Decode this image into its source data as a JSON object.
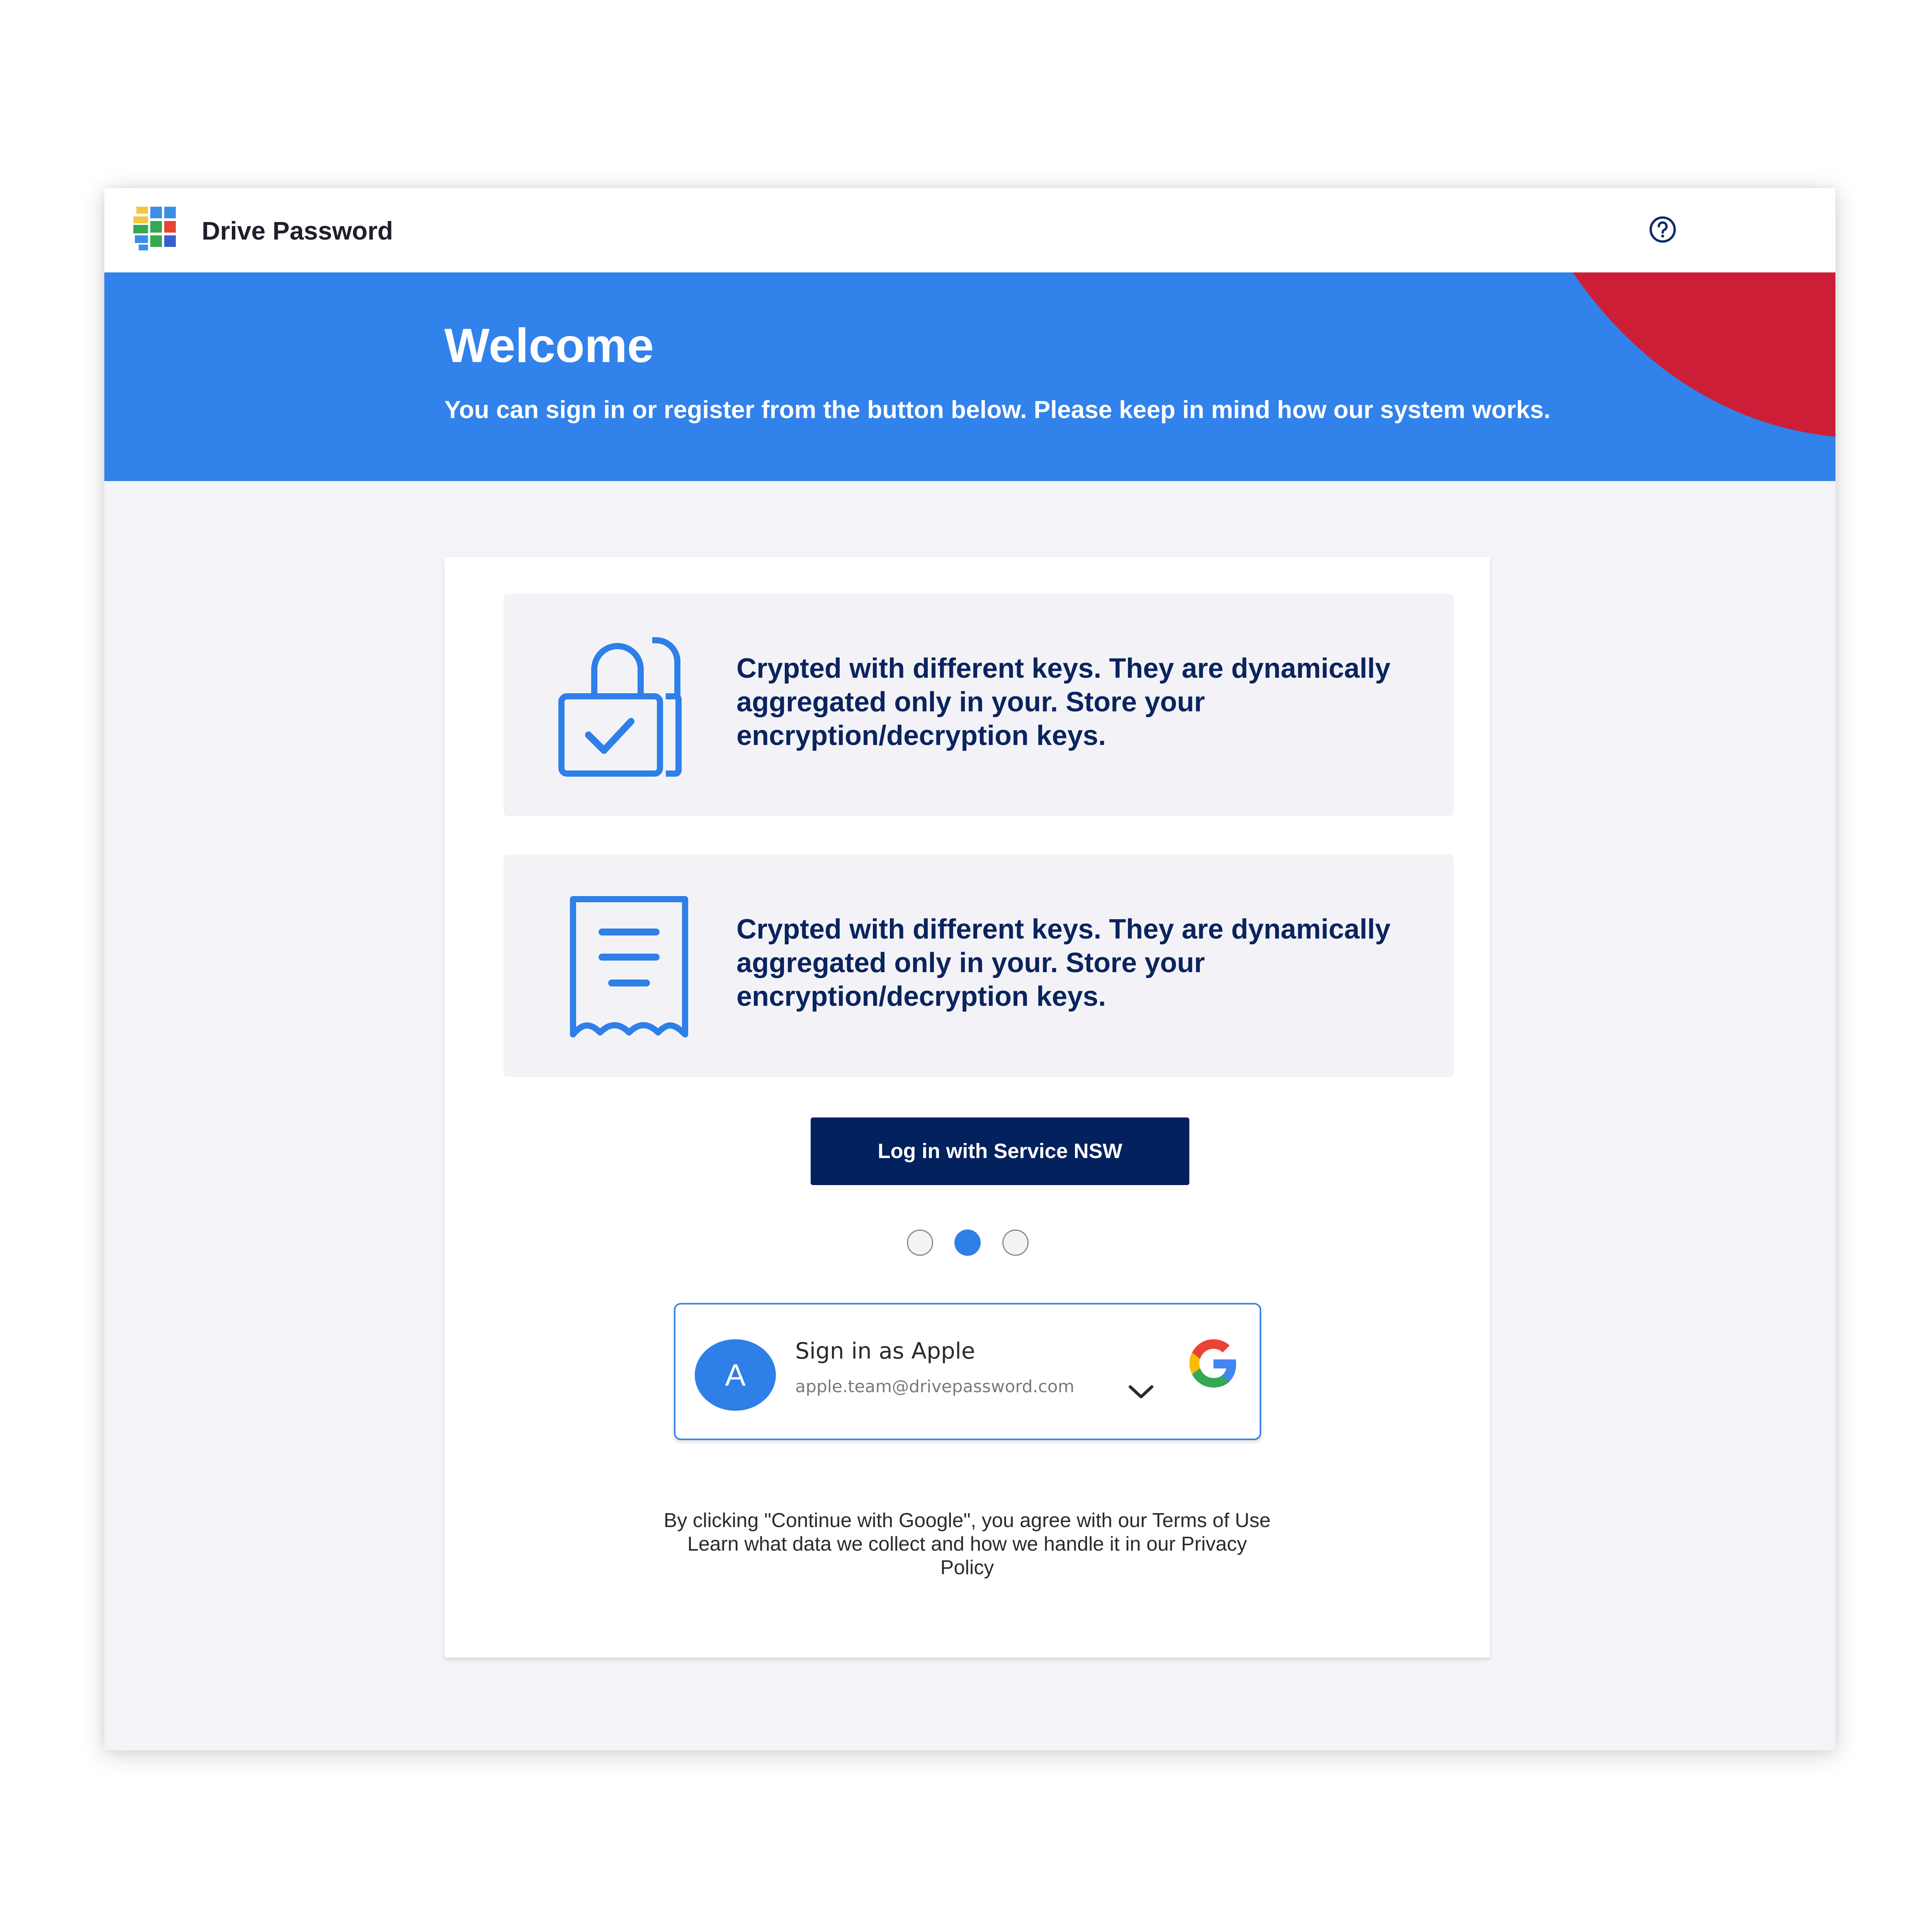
{
  "header": {
    "app_name": "Drive Password",
    "help_icon": "help-circle-icon"
  },
  "hero": {
    "title": "Welcome",
    "subtitle": "You can sign in or register from the button below. Please keep in mind how our system works.",
    "background_color": "#3282eb",
    "accent_color": "#cd1e37"
  },
  "features": [
    {
      "icon": "lock-check-icon",
      "text": "Crypted with different keys. They are dynamically aggregated only in your. Store your encryption/decryption keys."
    },
    {
      "icon": "receipt-icon",
      "text": "Crypted with different keys. They are dynamically aggregated only in your. Store your encryption/decryption keys."
    }
  ],
  "login_button": {
    "label": "Log in with Service NSW",
    "color": "#03215d"
  },
  "carousel": {
    "total": 3,
    "active_index": 1
  },
  "google_signin": {
    "avatar_initial": "A",
    "title": "Sign in as Apple",
    "email": "apple.team@drivepassword.com",
    "chevron_icon": "chevron-down-icon",
    "brand_icon": "google-logo-icon"
  },
  "legal": {
    "line1": "By clicking \"Continue with Google\", you agree with our Terms of Use",
    "line2": "Learn what data we collect and how we handle it in our Privacy",
    "line3": "Policy"
  }
}
